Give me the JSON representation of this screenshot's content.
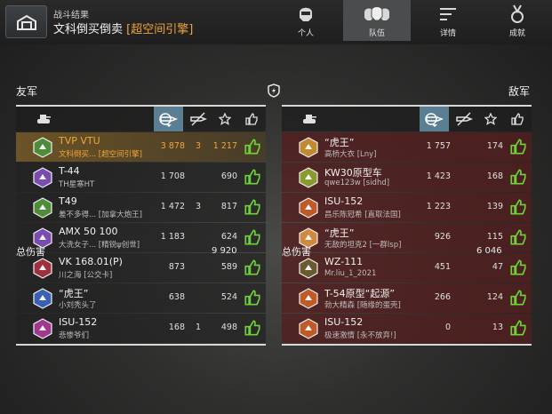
{
  "header": {
    "subtitle": "战斗结果",
    "title_main": "文科倒买倒卖",
    "title_mode": "[超空间引擎]",
    "tabs": [
      {
        "label": "个人",
        "icon": "commander-icon"
      },
      {
        "label": "队伍",
        "icon": "team-icon"
      },
      {
        "label": "详情",
        "icon": "details-icon"
      },
      {
        "label": "成就",
        "icon": "medal-icon"
      }
    ]
  },
  "ally": {
    "label": "友军",
    "total_label": "总伤害",
    "total": "9 920",
    "rows": [
      {
        "tank": "TVP VTU",
        "player": "文科倒买... [超空间引擎]",
        "damage": "3 878",
        "kills": "3",
        "exp": "1 217",
        "emblem": "#4e8c3a"
      },
      {
        "tank": "T-44",
        "player": "TH星寒HT",
        "damage": "1 708",
        "kills": "",
        "exp": "690",
        "emblem": "#7a4bb0"
      },
      {
        "tank": "T49",
        "player": "差不多得... [加拿大炮王]",
        "damage": "1 472",
        "kills": "3",
        "exp": "817",
        "emblem": "#4e8c3a"
      },
      {
        "tank": "AMX 50 100",
        "player": "大洗女子... [精锐ψ创世]",
        "damage": "1 183",
        "kills": "",
        "exp": "624",
        "emblem": "#7a4bb0"
      },
      {
        "tank": "VK 168.01(P)",
        "player": "川之海 [公交卡]",
        "damage": "873",
        "kills": "",
        "exp": "589",
        "emblem": "#a03040"
      },
      {
        "tank": "“虎王”",
        "player": "小刘秃头了",
        "damage": "638",
        "kills": "",
        "exp": "524",
        "emblem": "#3a60b0"
      },
      {
        "tank": "ISU-152",
        "player": "悲惨爷们",
        "damage": "168",
        "kills": "1",
        "exp": "498",
        "emblem": "#a03890"
      }
    ]
  },
  "enemy": {
    "label": "敌军",
    "total_label": "总伤害",
    "total": "6 046",
    "rows": [
      {
        "tank": "“虎王”",
        "player": "高桥大衣 [Lny]",
        "damage": "1 757",
        "kills": "",
        "exp": "174",
        "emblem": "#c08a30"
      },
      {
        "tank": "KW30原型车",
        "player": "qwe123w [sidhd]",
        "damage": "1 423",
        "kills": "",
        "exp": "168",
        "emblem": "#8a9a30"
      },
      {
        "tank": "ISU-152",
        "player": "昌乐陈冠希 [直取法国]",
        "damage": "1 223",
        "kills": "",
        "exp": "139",
        "emblem": "#c05a28"
      },
      {
        "tank": "“虎王”",
        "player": "无敌的坦克2 [一群lsp]",
        "damage": "926",
        "kills": "",
        "exp": "115",
        "emblem": "#d08a40"
      },
      {
        "tank": "WZ-111",
        "player": "Mr.liu_1_2021",
        "damage": "451",
        "kills": "",
        "exp": "47",
        "emblem": "#6a5a30"
      },
      {
        "tank": "T-54原型“起源”",
        "player": "勃大精森 [随缘的蛋壳]",
        "damage": "266",
        "kills": "",
        "exp": "124",
        "emblem": "#c05a28"
      },
      {
        "tank": "ISU-152",
        "player": "极速激情 [永不放弃!]",
        "damage": "0",
        "kills": "",
        "exp": "13",
        "emblem": "#c05a28"
      }
    ]
  },
  "colors": {
    "highlight": "#f0a53a",
    "like_green": "#6fd13a",
    "sorted_header": "#5b7f92"
  }
}
